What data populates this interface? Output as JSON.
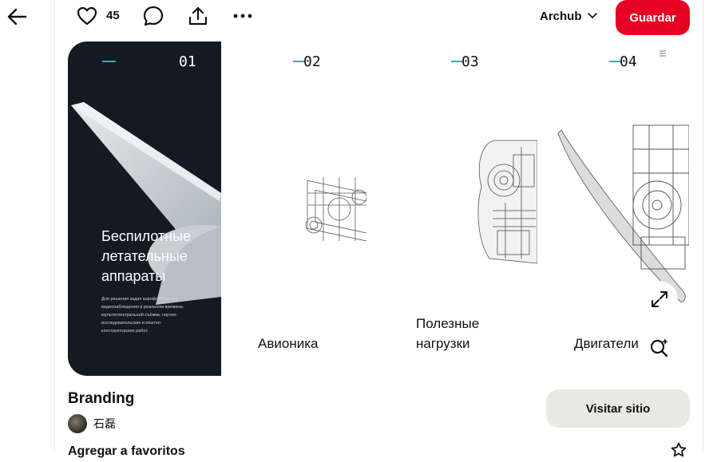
{
  "toolbar": {
    "back_icon": "arrow-left-icon",
    "like_icon": "heart-icon",
    "like_count": "45",
    "comment_icon": "comment-bubble-icon",
    "share_icon": "share-upload-icon",
    "more_icon": "more-dots-icon",
    "board_name": "Archub",
    "board_icon": "chevron-down-icon",
    "save_label": "Guardar"
  },
  "pin_image": {
    "panels": [
      {
        "number": "01",
        "title": "Беспилотные летательные аппараты",
        "description": "Для решения задач аэрофотосъёмки, видеонаблюдения в реальном времени, мультиспектральной съёмки, научно исследовательских и опытно-конструкторских работ."
      },
      {
        "number": "02",
        "title": "Авионика"
      },
      {
        "number": "03",
        "title": "Полезные нагрузки"
      },
      {
        "number": "04",
        "title": "Двигатели"
      }
    ],
    "expand_icon": "expand-icon",
    "visual_search_icon": "visual-search-icon"
  },
  "pin": {
    "title": "Branding",
    "creator_name": "石磊",
    "visit_label": "Visitar sitio",
    "favorites_label": "Agregar a favoritos",
    "star_icon": "star-icon"
  },
  "colors": {
    "save_button": "#e60023",
    "dark_panel": "#141a22",
    "accent_dash": "#4aa3b0",
    "visit_button": "#e9e9e4"
  }
}
